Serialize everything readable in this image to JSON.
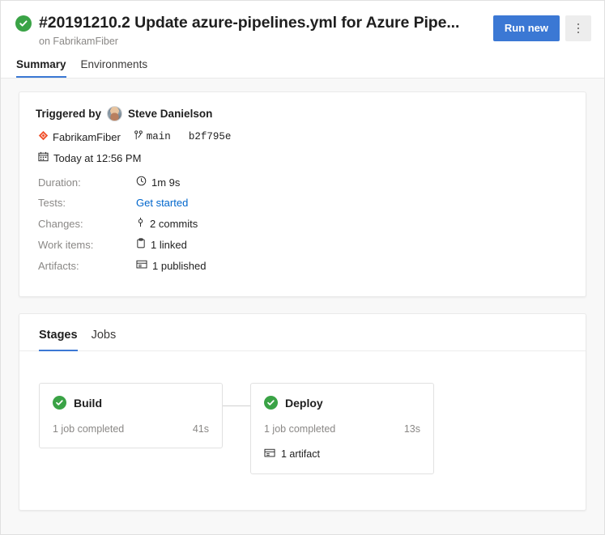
{
  "header": {
    "status_icon": "success-check-icon",
    "title": "#20191210.2 Update azure-pipelines.yml for Azure Pipe...",
    "subtitle": "on FabrikamFiber",
    "run_new_label": "Run new",
    "overflow_label": "more-actions"
  },
  "tabs": [
    {
      "label": "Summary",
      "active": true
    },
    {
      "label": "Environments",
      "active": false
    }
  ],
  "summary": {
    "triggered_by_label": "Triggered by",
    "triggered_by_user": "Steve Danielson",
    "repository": "FabrikamFiber",
    "branch": "main",
    "commit": "b2f795e",
    "date": "Today at 12:56 PM",
    "rows": [
      {
        "label": "Duration:",
        "value": "1m 9s",
        "icon": "clock-icon",
        "link": false
      },
      {
        "label": "Tests:",
        "value": "Get started",
        "icon": "",
        "link": true
      },
      {
        "label": "Changes:",
        "value": "2 commits",
        "icon": "commit-icon",
        "link": false
      },
      {
        "label": "Work items:",
        "value": "1 linked",
        "icon": "work-item-icon",
        "link": false
      },
      {
        "label": "Artifacts:",
        "value": "1 published",
        "icon": "package-icon",
        "link": false
      }
    ]
  },
  "stages_section": {
    "tabs": [
      {
        "label": "Stages",
        "active": true
      },
      {
        "label": "Jobs",
        "active": false
      }
    ],
    "stages": [
      {
        "name": "Build",
        "status_icon": "success-check-icon",
        "jobs": "1 job completed",
        "duration": "41s",
        "artifact": ""
      },
      {
        "name": "Deploy",
        "status_icon": "success-check-icon",
        "jobs": "1 job completed",
        "duration": "13s",
        "artifact": "1 artifact"
      }
    ]
  },
  "colors": {
    "accent_blue": "#3b78d4",
    "success_green": "#3aa346",
    "repo_red": "#f0512c",
    "link_blue": "#0066cc",
    "muted_text": "#8a8886",
    "page_bg": "#f8f8f8"
  }
}
